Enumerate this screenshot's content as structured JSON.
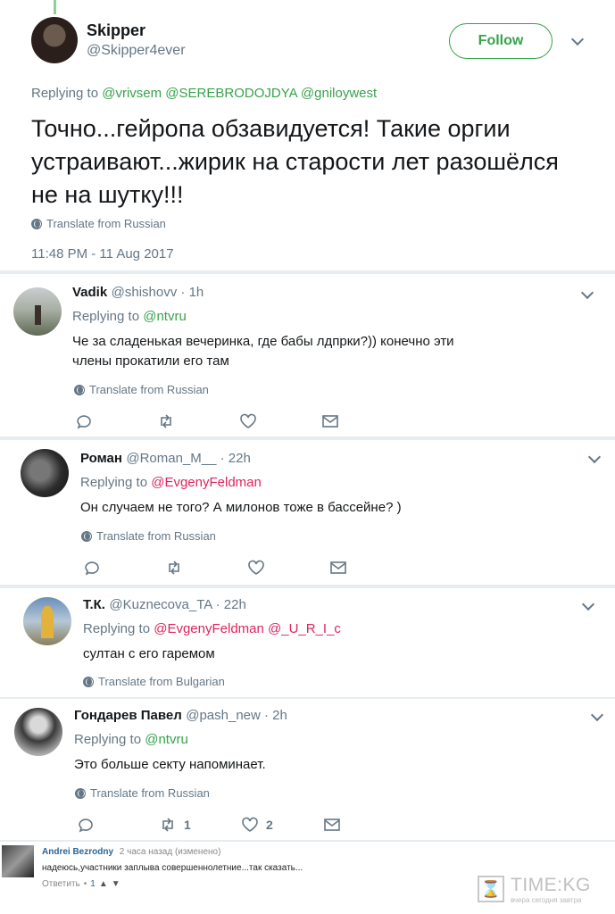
{
  "main_tweet": {
    "name": "Skipper",
    "handle": "@Skipper4ever",
    "follow_label": "Follow",
    "replying_prefix": "Replying to",
    "replying_to": "@vrivsem @SEREBRODOJDYA @gniloywest",
    "text": "Точно...гейропа обзавидуется! Такие оргии устраивают...жирик на старости лет разошёлся не на шутку!!!",
    "translate": "Translate from Russian",
    "timestamp": "11:48 PM - 11 Aug 2017"
  },
  "replies": [
    {
      "name": "Vadik",
      "handle": "@shishovv · 1h",
      "replying_prefix": "Replying to",
      "replying_to": "@ntvru",
      "text": "Че за сладенькая вечеринка, где бабы лдпрки?)) конечно эти члены прокатили его там",
      "translate": "Translate from Russian",
      "retweets": "",
      "likes": ""
    },
    {
      "name": "Роман",
      "handle": "@Roman_M__ · 22h",
      "replying_prefix": "Replying to",
      "replying_to": "@EvgenyFeldman",
      "text": "Он случаем не того?  А милонов тоже в бассейне? )",
      "translate": "Translate from Russian",
      "retweets": "",
      "likes": ""
    },
    {
      "name": "Т.К.",
      "handle": "@Kuznecova_TA · 22h",
      "replying_prefix": "Replying to",
      "replying_to": "@EvgenyFeldman @_U_R_I_c",
      "text": "султан с его гаремом",
      "translate": "Translate from Bulgarian"
    },
    {
      "name": "Гондарев Павел",
      "handle": "@pash_new · 2h",
      "replying_prefix": "Replying to",
      "replying_to": "@ntvru",
      "text": "Это больше секту напоминает.",
      "translate": "Translate from Russian",
      "retweets": "1",
      "likes": "2"
    }
  ],
  "comment": {
    "name": "Andrei Bezrodny",
    "meta": "2 часа назад (изменено)",
    "text": "надеюсь,участники заплыва совершеннолетние...так сказать...",
    "reply_label": "Ответить",
    "separator": "•",
    "votes": "1"
  },
  "watermark": {
    "logo": "TIME:KG",
    "tagline": "вчера сегодня завтра"
  },
  "colors": {
    "green_link": "#37a24b",
    "red_link": "#e0245e",
    "follow_border": "#37a24b",
    "comment_name": "#2a6496"
  }
}
